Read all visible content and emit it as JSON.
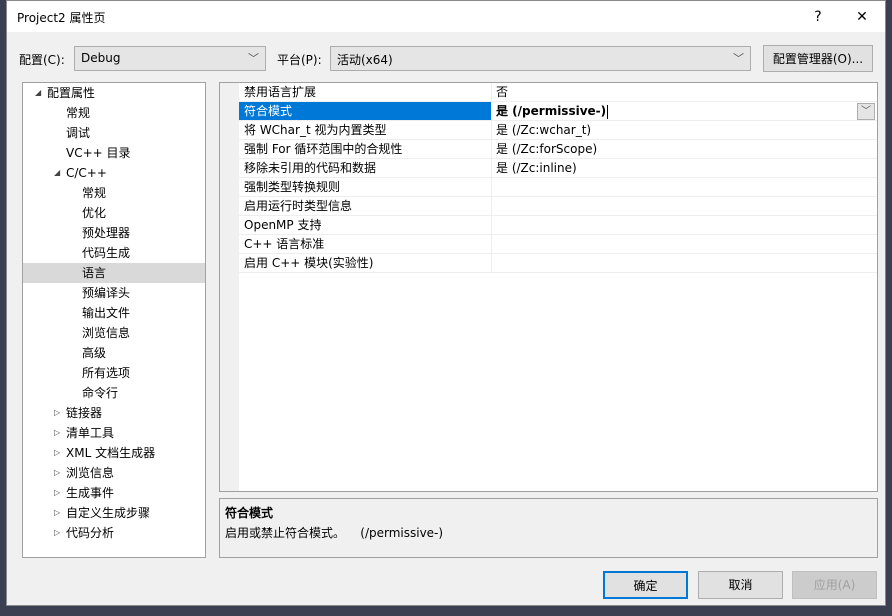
{
  "window": {
    "title": "Project2 属性页",
    "help": "?",
    "close": "✕"
  },
  "toolbar": {
    "config_label": "配置(C):",
    "config_value": "Debug",
    "platform_label": "平台(P):",
    "platform_value": "活动(x64)",
    "manager_button": "配置管理器(O)..."
  },
  "tree": [
    {
      "label": "配置属性",
      "level": 0,
      "expander": "expanded"
    },
    {
      "label": "常规",
      "level": 1
    },
    {
      "label": "调试",
      "level": 1
    },
    {
      "label": "VC++ 目录",
      "level": 1
    },
    {
      "label": "C/C++",
      "level": 1,
      "expander": "expanded"
    },
    {
      "label": "常规",
      "level": 2
    },
    {
      "label": "优化",
      "level": 2
    },
    {
      "label": "预处理器",
      "level": 2
    },
    {
      "label": "代码生成",
      "level": 2
    },
    {
      "label": "语言",
      "level": 2,
      "selected": true
    },
    {
      "label": "预编译头",
      "level": 2
    },
    {
      "label": "输出文件",
      "level": 2
    },
    {
      "label": "浏览信息",
      "level": 2
    },
    {
      "label": "高级",
      "level": 2
    },
    {
      "label": "所有选项",
      "level": 2
    },
    {
      "label": "命令行",
      "level": 2
    },
    {
      "label": "链接器",
      "level": 1,
      "expander": "collapsed"
    },
    {
      "label": "清单工具",
      "level": 1,
      "expander": "collapsed"
    },
    {
      "label": "XML 文档生成器",
      "level": 1,
      "expander": "collapsed"
    },
    {
      "label": "浏览信息",
      "level": 1,
      "expander": "collapsed"
    },
    {
      "label": "生成事件",
      "level": 1,
      "expander": "collapsed"
    },
    {
      "label": "自定义生成步骤",
      "level": 1,
      "expander": "collapsed"
    },
    {
      "label": "代码分析",
      "level": 1,
      "expander": "collapsed"
    }
  ],
  "properties": [
    {
      "name": "禁用语言扩展",
      "value": "否"
    },
    {
      "name": "符合模式",
      "value": "是 (/permissive-)",
      "selected": true
    },
    {
      "name": "将 WChar_t 视为内置类型",
      "value": "是 (/Zc:wchar_t)"
    },
    {
      "name": "强制 For 循环范围中的合规性",
      "value": "是 (/Zc:forScope)"
    },
    {
      "name": "移除未引用的代码和数据",
      "value": "是 (/Zc:inline)"
    },
    {
      "name": "强制类型转换规则",
      "value": ""
    },
    {
      "name": "启用运行时类型信息",
      "value": ""
    },
    {
      "name": "OpenMP 支持",
      "value": ""
    },
    {
      "name": "C++ 语言标准",
      "value": ""
    },
    {
      "name": "启用 C++ 模块(实验性)",
      "value": ""
    }
  ],
  "description": {
    "title": "符合模式",
    "text": "启用或禁止符合模式。    (/permissive-)"
  },
  "buttons": {
    "ok": "确定",
    "cancel": "取消",
    "apply": "应用(A)"
  },
  "colors": {
    "selection": "#0078d7",
    "ok_border": "#0078d7"
  }
}
